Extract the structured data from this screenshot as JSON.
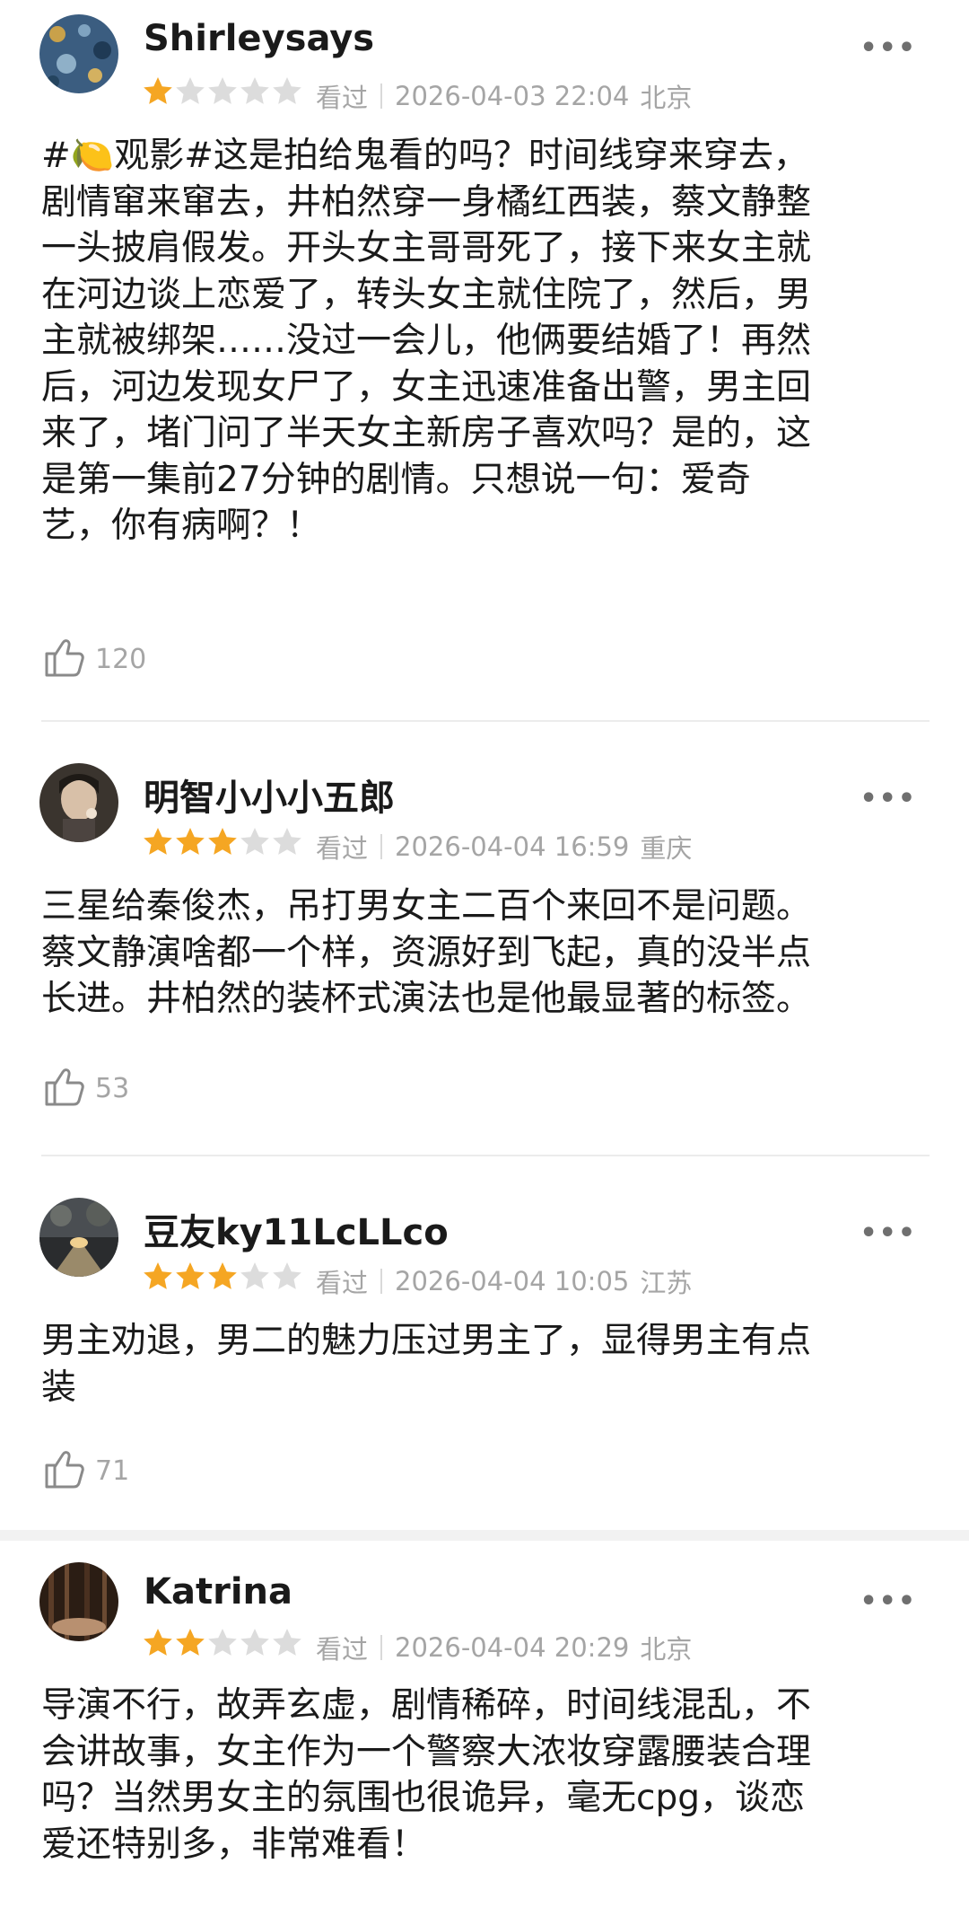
{
  "reviews": [
    {
      "user": "Shirleysays",
      "rating": 1,
      "status": "看过",
      "datetime": "2026-04-03 22:04",
      "location": "北京",
      "lines": [
        "#🍋观影#这是拍给鬼看的吗？时间线穿来穿去，",
        "剧情窜来窜去，井柏然穿一身橘红西装，蔡文静整",
        "一头披肩假发。开头女主哥哥死了，接下来女主就",
        "在河边谈上恋爱了，转头女主就住院了，然后，男",
        "主就被绑架……没过一会儿，他俩要结婚了！再然",
        "后，河边发现女尸了，女主迅速准备出警，男主回",
        "来了，堵门问了半天女主新房子喜欢吗？是的，这",
        "是第一集前27分钟的剧情。只想说一句：爱奇",
        "艺，你有病啊？！"
      ],
      "likes": "120",
      "avatar_colors": [
        "#2c4a6b",
        "#6f8fa8",
        "#c9a14a"
      ]
    },
    {
      "user": "明智小小小五郎",
      "rating": 3,
      "status": "看过",
      "datetime": "2026-04-04 16:59",
      "location": "重庆",
      "lines": [
        "三星给秦俊杰，吊打男女主二百个来回不是问题。",
        "蔡文静演啥都一个样，资源好到飞起，真的没半点",
        "长进。井柏然的装杯式演法也是他最显著的标签。"
      ],
      "likes": "53",
      "avatar_colors": [
        "#2a2622",
        "#8a7a6c",
        "#d8c8b8"
      ]
    },
    {
      "user": "豆友ky11LcLLco",
      "rating": 3,
      "status": "看过",
      "datetime": "2026-04-04 10:05",
      "location": "江苏",
      "lines": [
        "男主劝退，男二的魅力压过男主了，显得男主有点",
        "装"
      ],
      "likes": "71",
      "avatar_colors": [
        "#3a3d40",
        "#7f7a6e",
        "#e2c58a"
      ]
    },
    {
      "user": "Katrina",
      "rating": 2,
      "status": "看过",
      "datetime": "2026-04-04 20:29",
      "location": "北京",
      "lines": [
        "导演不行，故弄玄虚，剧情稀碎，时间线混乱，不",
        "会讲故事，女主作为一个警察大浓妆穿露腰装合理",
        "吗？当然男女主的氛围也很诡异，毫无cpg，谈恋",
        "爱还特别多，非常难看！"
      ],
      "likes": "",
      "avatar_colors": [
        "#2b1d14",
        "#6b4a32",
        "#b89070"
      ]
    }
  ],
  "ui": {
    "more_glyph": "•••",
    "star_on_color": "#f5a623",
    "star_off_color": "#dcdcdc"
  }
}
